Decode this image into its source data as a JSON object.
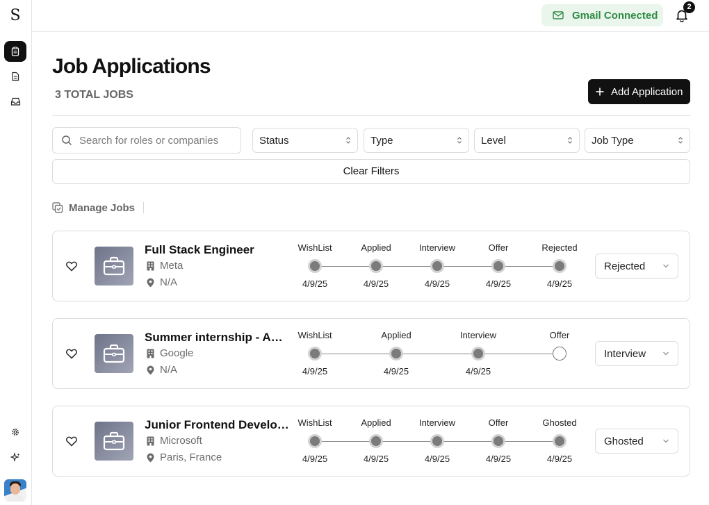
{
  "app": {
    "logo": "S"
  },
  "sidebar": {
    "items": [
      {
        "icon": "clipboard-icon",
        "active": true
      },
      {
        "icon": "document-icon",
        "active": false
      },
      {
        "icon": "inbox-icon",
        "active": false
      }
    ],
    "bottom": [
      {
        "icon": "gear-icon"
      },
      {
        "icon": "sparkle-icon"
      }
    ]
  },
  "header": {
    "gmail_label": "Gmail Connected",
    "notification_count": "2"
  },
  "page": {
    "title": "Job Applications",
    "total": "3 TOTAL JOBS",
    "add_label": "Add Application"
  },
  "filters": {
    "search_placeholder": "Search for roles or companies",
    "status": "Status",
    "type": "Type",
    "level": "Level",
    "job_type": "Job Type",
    "clear_label": "Clear Filters"
  },
  "manage_label": "Manage Jobs",
  "jobs": [
    {
      "title": "Full Stack Engineer",
      "company": "Meta",
      "location": "N/A",
      "status": "Rejected",
      "stages": [
        {
          "label": "WishList",
          "date": "4/9/25"
        },
        {
          "label": "Applied",
          "date": "4/9/25"
        },
        {
          "label": "Interview",
          "date": "4/9/25"
        },
        {
          "label": "Offer",
          "date": "4/9/25"
        },
        {
          "label": "Rejected",
          "date": "4/9/25"
        }
      ]
    },
    {
      "title": "Summer internship - AI ...",
      "company": "Google",
      "location": "N/A",
      "status": "Interview",
      "stages": [
        {
          "label": "WishList",
          "date": "4/9/25"
        },
        {
          "label": "Applied",
          "date": "4/9/25"
        },
        {
          "label": "Interview",
          "date": "4/9/25"
        },
        {
          "label": "Offer",
          "date": ""
        }
      ]
    },
    {
      "title": "Junior Frontend Developer",
      "company": "Microsoft",
      "location": "Paris, France",
      "status": "Ghosted",
      "stages": [
        {
          "label": "WishList",
          "date": "4/9/25"
        },
        {
          "label": "Applied",
          "date": "4/9/25"
        },
        {
          "label": "Interview",
          "date": "4/9/25"
        },
        {
          "label": "Offer",
          "date": "4/9/25"
        },
        {
          "label": "Ghosted",
          "date": "4/9/25"
        }
      ]
    }
  ]
}
